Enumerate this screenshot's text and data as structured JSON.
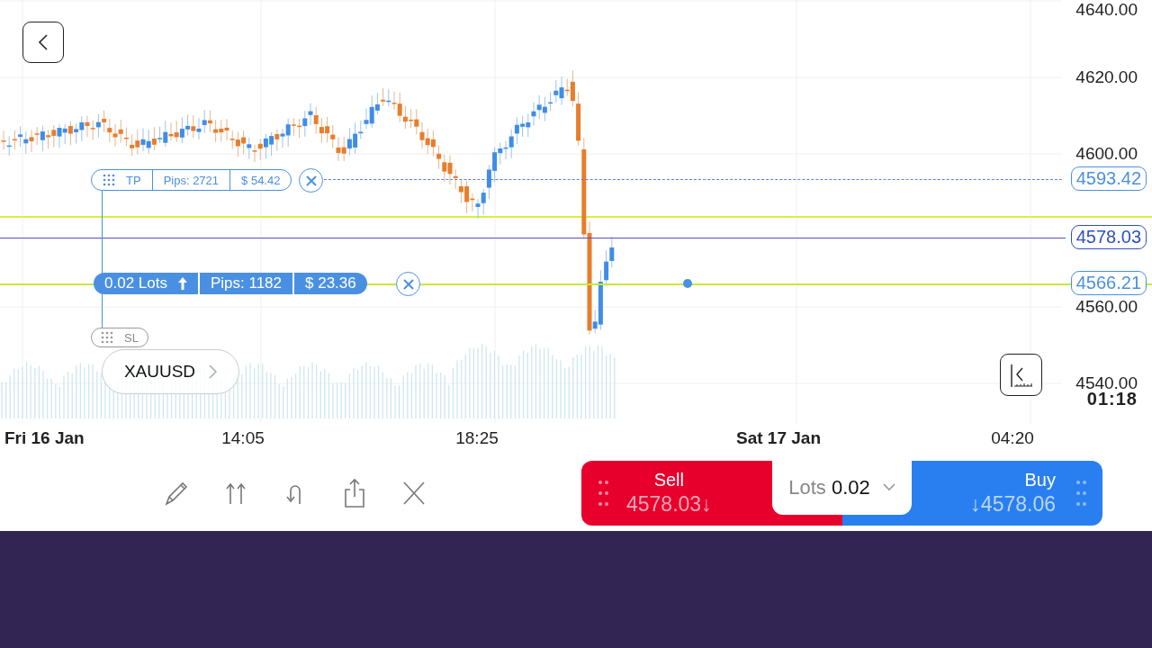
{
  "price_axis": {
    "ticks": [
      "4640.00",
      "4620.00",
      "4600.00",
      "4560.00",
      "4540.00"
    ]
  },
  "countdown": "01:18",
  "time_axis": {
    "labels": [
      {
        "text": "Fri 16 Jan",
        "bold": true
      },
      {
        "text": "14:05",
        "bold": false
      },
      {
        "text": "18:25",
        "bold": false
      },
      {
        "text": "Sat 17 Jan",
        "bold": true
      },
      {
        "text": "04:20",
        "bold": false
      }
    ]
  },
  "price_lines": [
    {
      "kind": "take_profit",
      "label": "4593.42"
    },
    {
      "kind": "current",
      "label": "4578.03"
    },
    {
      "kind": "entry",
      "label": "4566.21"
    }
  ],
  "take_profit": {
    "handle": "TP",
    "pips": "Pips: 2721",
    "amount": "$ 54.42"
  },
  "position": {
    "lots": "0.02 Lots",
    "pips": "Pips: 1182",
    "amount": "$ 23.36"
  },
  "stop_loss": {
    "handle": "SL"
  },
  "symbol": "XAUUSD",
  "toolbar": [
    {
      "kind": "pencil"
    },
    {
      "kind": "arrows"
    },
    {
      "kind": "undo"
    },
    {
      "kind": "share"
    },
    {
      "kind": "close"
    }
  ],
  "trade": {
    "sell_label": "Sell",
    "sell_price": "4578.03↓",
    "lots_label": "Lots",
    "lots_value": "0.02",
    "buy_label": "Buy",
    "buy_price": "↓4578.06"
  }
}
